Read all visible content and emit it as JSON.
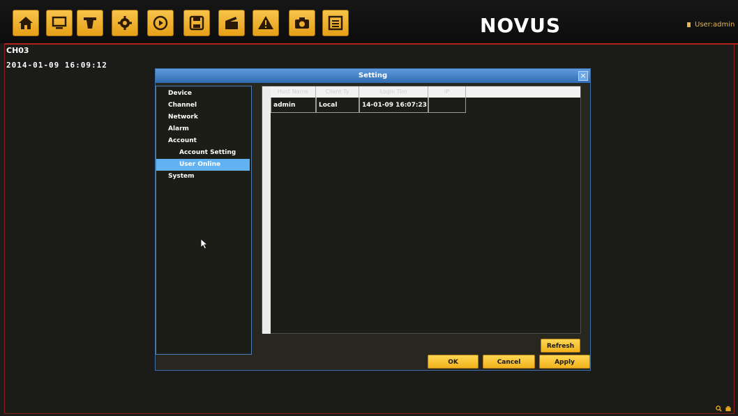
{
  "toolbar": {
    "buttons": [
      {
        "name": "home-button",
        "icon": "home-icon"
      },
      {
        "name": "monitor-button",
        "icon": "monitor-icon"
      },
      {
        "name": "camera-button",
        "icon": "camera-icon"
      },
      {
        "name": "settings-button",
        "icon": "gear-icon"
      },
      {
        "name": "playback-button",
        "icon": "play-icon"
      },
      {
        "name": "backup-button",
        "icon": "save-icon"
      },
      {
        "name": "record-button",
        "icon": "clapper-icon"
      },
      {
        "name": "alarm-button",
        "icon": "warning-icon"
      },
      {
        "name": "snapshot-button",
        "icon": "photo-camera-icon"
      },
      {
        "name": "log-button",
        "icon": "list-icon"
      }
    ],
    "accent": "#f1b21c"
  },
  "logo": {
    "text": "NOVUS"
  },
  "user": {
    "label": "User:admin"
  },
  "overlay": {
    "channel": "CH03",
    "datetime": "2014-01-09 16:09:12"
  },
  "dialog": {
    "title": "Setting",
    "close_label": "×",
    "menu": [
      {
        "label": "Device",
        "level": 0
      },
      {
        "label": "Channel",
        "level": 0
      },
      {
        "label": "Network",
        "level": 0
      },
      {
        "label": "Alarm",
        "level": 0
      },
      {
        "label": "Account",
        "level": 0
      },
      {
        "label": "Account Setting",
        "level": 1
      },
      {
        "label": "User Online",
        "level": 1,
        "selected": true
      },
      {
        "label": "System",
        "level": 0
      }
    ],
    "table": {
      "columns": [
        "Host Name",
        "Client Ty",
        "Login Tim",
        "IP"
      ],
      "rows": [
        [
          "admin",
          "Local",
          "14-01-09 16:07:23",
          ""
        ]
      ]
    },
    "buttons": {
      "refresh": "Refresh",
      "ok": "OK",
      "cancel": "Cancel",
      "apply": "Apply"
    }
  }
}
